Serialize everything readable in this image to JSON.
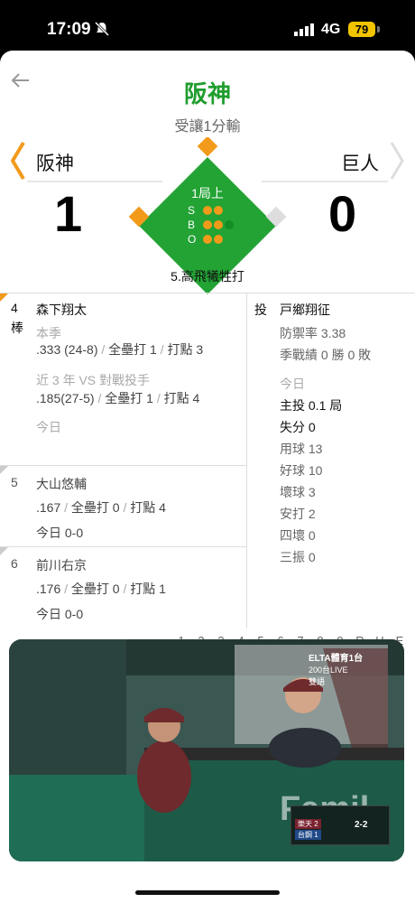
{
  "status_bar": {
    "time": "17:09",
    "network": "4G",
    "battery": "79"
  },
  "header": {
    "title": "阪神",
    "subtitle": "受讓1分輸"
  },
  "teams": {
    "home": {
      "name": "阪神",
      "score": "1"
    },
    "away": {
      "name": "巨人",
      "score": "0"
    }
  },
  "field": {
    "inning": "1局上",
    "strike_label": "S",
    "ball_label": "B",
    "out_label": "O",
    "strikes": 2,
    "balls": 2,
    "outs": 2,
    "colors": {
      "field": "#22a334",
      "accent": "#f29a1a"
    }
  },
  "last_play": "5.高飛犧牲打",
  "batters": [
    {
      "order": "4",
      "role": "棒",
      "name": "森下翔太",
      "season_label": "本季",
      "season_line": [
        ".333 (24-8)",
        "全壘打 1",
        "打點 3"
      ],
      "vs_label": "近 3 年 VS 對戰投手",
      "vs_line": [
        ".185(27-5)",
        "全壘打 1",
        "打點 4"
      ],
      "today_label": "今日"
    },
    {
      "order": "5",
      "name": "大山悠輔",
      "season_line": [
        ".167",
        "全壘打 0",
        "打點 4"
      ],
      "today": "今日 0-0"
    },
    {
      "order": "6",
      "name": "前川右京",
      "season_line": [
        ".176",
        "全壘打 0",
        "打點 1"
      ],
      "today": "今日 0-0"
    }
  ],
  "pitcher": {
    "position": "投",
    "name": "戸鄉翔征",
    "era": "防禦率 3.38",
    "record": "季戰績 0 勝 0 敗",
    "today_label": "今日",
    "ip": "主投 0.1 局",
    "runs": "失分 0",
    "pitches": "用球 13",
    "strikes": "好球 10",
    "balls": "壞球 3",
    "hits": "安打 2",
    "walks": "四壞 0",
    "strikeouts": "三振 0"
  },
  "linescore_header": [
    "1",
    "2",
    "3",
    "4",
    "5",
    "6",
    "7",
    "8",
    "9",
    "R",
    "H",
    "E"
  ],
  "video": {
    "channel": "ELTA體育1台",
    "live": "200台LIVE",
    "lang": "雙語",
    "scorebug_teams": [
      "樂天",
      "台鋼"
    ],
    "scorebug_scores": [
      "2",
      "1"
    ],
    "scorebug_count": "2-2"
  }
}
